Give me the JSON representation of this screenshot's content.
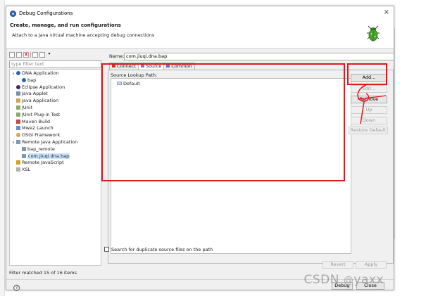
{
  "window": {
    "title": "Debug Configurations",
    "close_glyph": "×"
  },
  "header": {
    "heading": "Create, manage, and run configurations",
    "subtitle": "Attach to a Java virtual machine accepting debug connections"
  },
  "left": {
    "filter_placeholder": "type filter text",
    "tree": [
      {
        "label": "DNA Application",
        "icon": "dna-app-icon",
        "expanded": true,
        "level": 0
      },
      {
        "label": "bap",
        "icon": "dna-app-icon",
        "level": 1
      },
      {
        "label": "Eclipse Application",
        "icon": "eclipse-icon",
        "level": 0
      },
      {
        "label": "Java Applet",
        "icon": "java-applet-icon",
        "level": 0
      },
      {
        "label": "Java Application",
        "icon": "java-app-icon",
        "level": 0
      },
      {
        "label": "JUnit",
        "icon": "junit-icon",
        "level": 0
      },
      {
        "label": "JUnit Plug-in Test",
        "icon": "junit-plugin-icon",
        "level": 0
      },
      {
        "label": "Maven Build",
        "icon": "maven-icon",
        "level": 0
      },
      {
        "label": "Mwe2 Launch",
        "icon": "mwe2-icon",
        "level": 0
      },
      {
        "label": "OSGi Framework",
        "icon": "osgi-icon",
        "level": 0
      },
      {
        "label": "Remote Java Application",
        "icon": "remote-java-icon",
        "expanded": true,
        "level": 0
      },
      {
        "label": "bap_remote",
        "icon": "remote-java-icon",
        "level": 1
      },
      {
        "label": "com.jiuqi.dna.bap",
        "icon": "remote-java-icon",
        "level": 1,
        "selected": true
      },
      {
        "label": "Remote JavaScript",
        "icon": "remote-js-icon",
        "level": 0
      },
      {
        "label": "XSL",
        "icon": "xsl-icon",
        "level": 0
      }
    ],
    "status": "Filter matched 15 of 16 items"
  },
  "right": {
    "name_label": "Name:",
    "name_value": "com.jiuqi.dna.bap",
    "tabs": [
      {
        "label": "Connect",
        "icon": "connect-icon"
      },
      {
        "label": "Source",
        "icon": "source-icon",
        "active": true
      },
      {
        "label": "Common",
        "icon": "common-icon"
      }
    ],
    "source_lookup_label": "Source Lookup Path:",
    "source_items": [
      {
        "label": "Default",
        "icon": "folder-icon"
      }
    ],
    "buttons": {
      "add": "Add...",
      "edit": "Edit...",
      "remove": "Remove",
      "up": "Up",
      "down": "Down",
      "restore": "Restore Default"
    },
    "duplicate_checkbox_label": "Search for duplicate source files on the path",
    "revert": "Revert",
    "apply": "Apply"
  },
  "footer": {
    "help": "?",
    "debug": "Debug",
    "close": "Close"
  },
  "watermark": {
    "prefix": "CSDN ",
    "at": "@",
    "name": "yaxx"
  },
  "colors": {
    "annotation_red": "#e0191f",
    "selection": "#cce5ff",
    "dialog_bg": "#f0f0f0"
  }
}
